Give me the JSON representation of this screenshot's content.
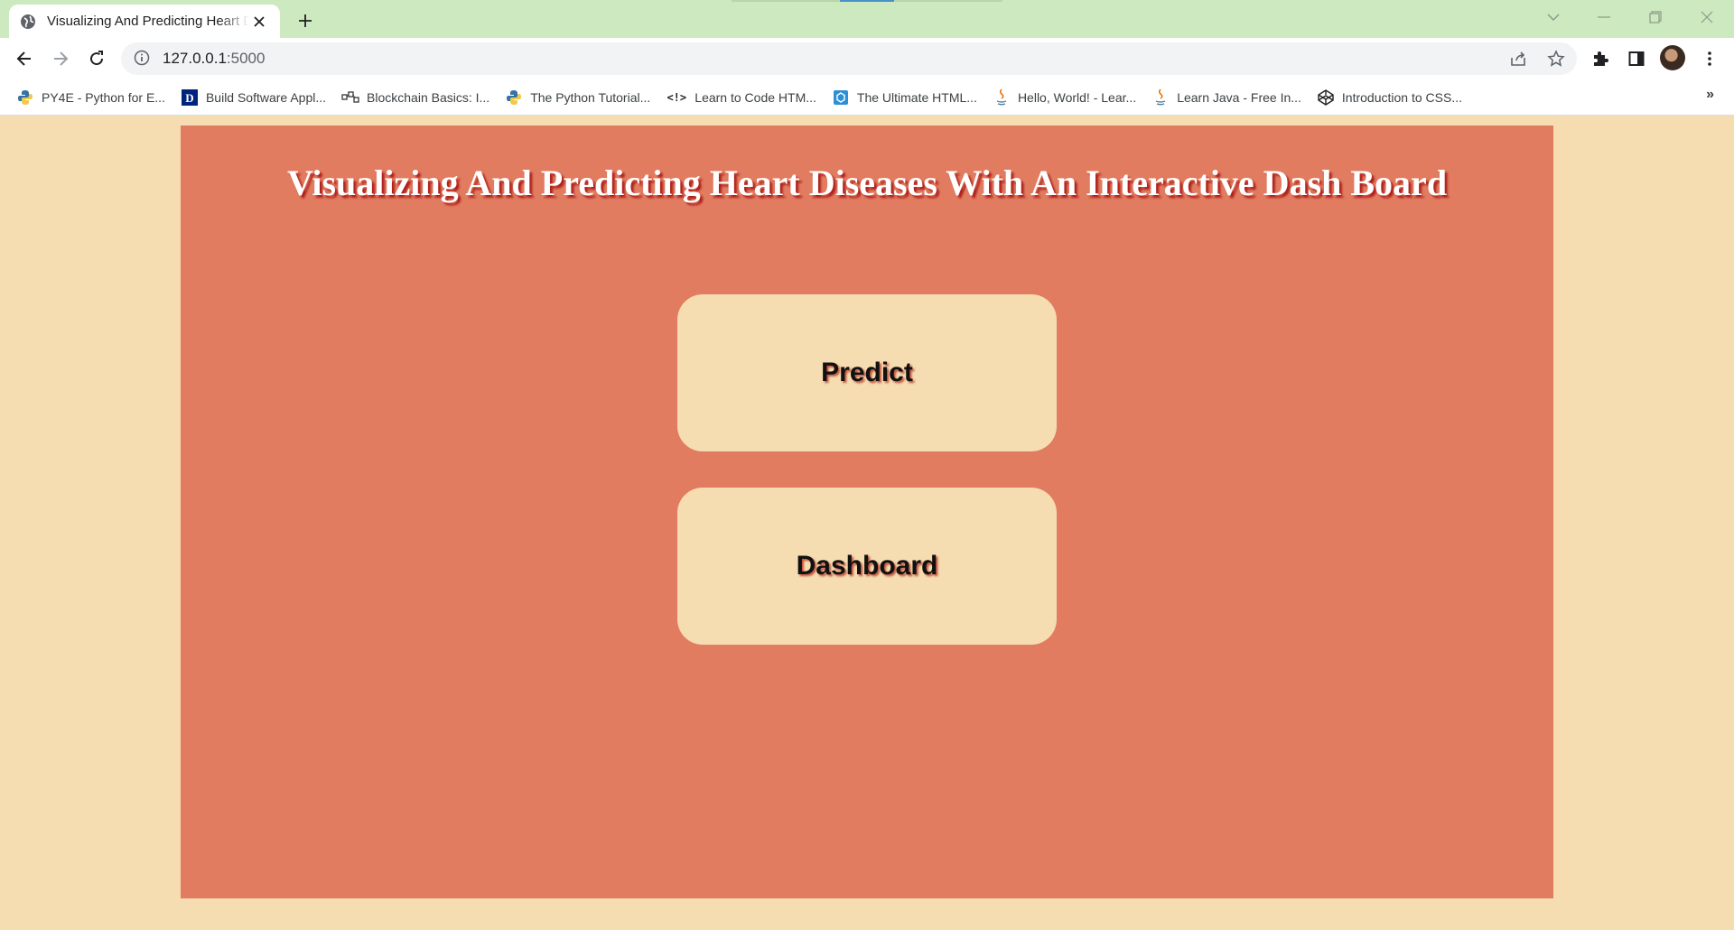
{
  "browser": {
    "tab": {
      "title": "Visualizing And Predicting Heart Diseases With An Interactive Dash Board",
      "favicon": "globe-icon"
    },
    "address_bar": {
      "host": "127.0.0.1",
      "port": ":5000"
    },
    "bookmarks": [
      {
        "label": "PY4E - Python for E...",
        "icon": "python-icon"
      },
      {
        "label": "Build Software Appl...",
        "icon": "duke-icon"
      },
      {
        "label": "Blockchain Basics: I...",
        "icon": "blockchain-icon"
      },
      {
        "label": "The Python Tutorial...",
        "icon": "python-icon"
      },
      {
        "label": "Learn to Code HTM...",
        "icon": "code-icon"
      },
      {
        "label": "The Ultimate HTML...",
        "icon": "html-icon"
      },
      {
        "label": "Hello, World! - Lear...",
        "icon": "java-icon"
      },
      {
        "label": "Learn Java - Free In...",
        "icon": "java-icon"
      },
      {
        "label": "Introduction to CSS...",
        "icon": "codepen-icon"
      }
    ],
    "bookmarks_overflow": "»",
    "colors": {
      "tab_strip": "#cde9bf",
      "toolbar": "#ffffff"
    }
  },
  "page": {
    "heading": "Visualizing And Predicting Heart Diseases With An Interactive Dash Board",
    "buttons": {
      "predict": "Predict",
      "dashboard": "Dashboard"
    },
    "colors": {
      "background": "#f5dcb1",
      "panel": "#e17c60",
      "button": "#f5dcb1",
      "heading_shadow": "#b0221c"
    }
  }
}
